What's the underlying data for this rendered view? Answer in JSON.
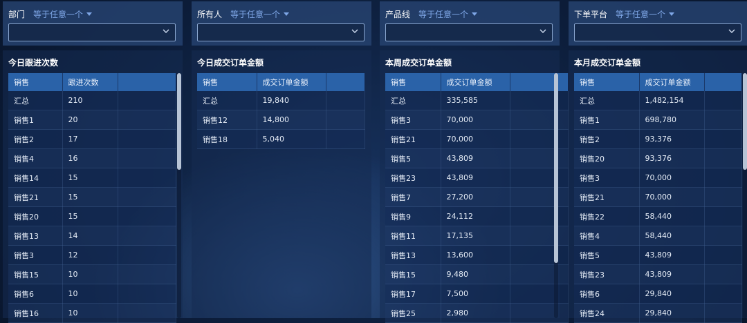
{
  "columns": [
    {
      "filter": {
        "label": "部门",
        "operator": "等于任意一个"
      },
      "card": {
        "title": "今日跟进次数",
        "headers": [
          "销售",
          "跟进次数",
          ""
        ],
        "rows": [
          [
            "汇总",
            "210"
          ],
          [
            "销售1",
            "20"
          ],
          [
            "销售2",
            "17"
          ],
          [
            "销售4",
            "16"
          ],
          [
            "销售14",
            "15"
          ],
          [
            "销售21",
            "15"
          ],
          [
            "销售20",
            "15"
          ],
          [
            "销售13",
            "14"
          ],
          [
            "销售3",
            "12"
          ],
          [
            "销售15",
            "10"
          ],
          [
            "销售6",
            "10"
          ],
          [
            "销售16",
            "10"
          ]
        ],
        "scroll_position": 0.0
      }
    },
    {
      "filter": {
        "label": "所有人",
        "operator": "等于任意一个"
      },
      "card": {
        "title": "今日成交订单金额",
        "headers": [
          "销售",
          "成交订单金额",
          ""
        ],
        "rows": [
          [
            "汇总",
            "19,840"
          ],
          [
            "销售12",
            "14,800"
          ],
          [
            "销售18",
            "5,040"
          ]
        ],
        "scroll_position": null
      }
    },
    {
      "filter": {
        "label": "产品线",
        "operator": "等于任意一个"
      },
      "card": {
        "title": "本周成交订单金额",
        "headers": [
          "销售",
          "成交订单金额",
          ""
        ],
        "rows": [
          [
            "汇总",
            "335,585"
          ],
          [
            "销售3",
            "70,000"
          ],
          [
            "销售21",
            "70,000"
          ],
          [
            "销售5",
            "43,809"
          ],
          [
            "销售23",
            "43,809"
          ],
          [
            "销售7",
            "27,200"
          ],
          [
            "销售9",
            "24,112"
          ],
          [
            "销售11",
            "17,135"
          ],
          [
            "销售13",
            "13,600"
          ],
          [
            "销售15",
            "9,480"
          ],
          [
            "销售17",
            "7,500"
          ],
          [
            "销售25",
            "2,980"
          ]
        ],
        "scroll_position": 0.0
      }
    },
    {
      "filter": {
        "label": "下单平台",
        "operator": "等于任意一个"
      },
      "card": {
        "title": "本月成交订单金额",
        "headers": [
          "销售",
          "成交订单金额",
          ""
        ],
        "rows": [
          [
            "汇总",
            "1,482,154"
          ],
          [
            "销售1",
            "698,780"
          ],
          [
            "销售2",
            "93,376"
          ],
          [
            "销售20",
            "93,376"
          ],
          [
            "销售3",
            "70,000"
          ],
          [
            "销售21",
            "70,000"
          ],
          [
            "销售22",
            "58,440"
          ],
          [
            "销售4",
            "58,440"
          ],
          [
            "销售5",
            "43,809"
          ],
          [
            "销售23",
            "43,809"
          ],
          [
            "销售6",
            "29,840"
          ],
          [
            "销售24",
            "29,840"
          ]
        ],
        "scroll_position": 0.0
      }
    }
  ],
  "colors": {
    "header_bg": "#2a62a8",
    "operator": "#7ea6e6",
    "panel": "#26426e"
  },
  "icons": {
    "operator_caret": "caret-down-icon",
    "select_chevron": "chevron-down-icon"
  }
}
